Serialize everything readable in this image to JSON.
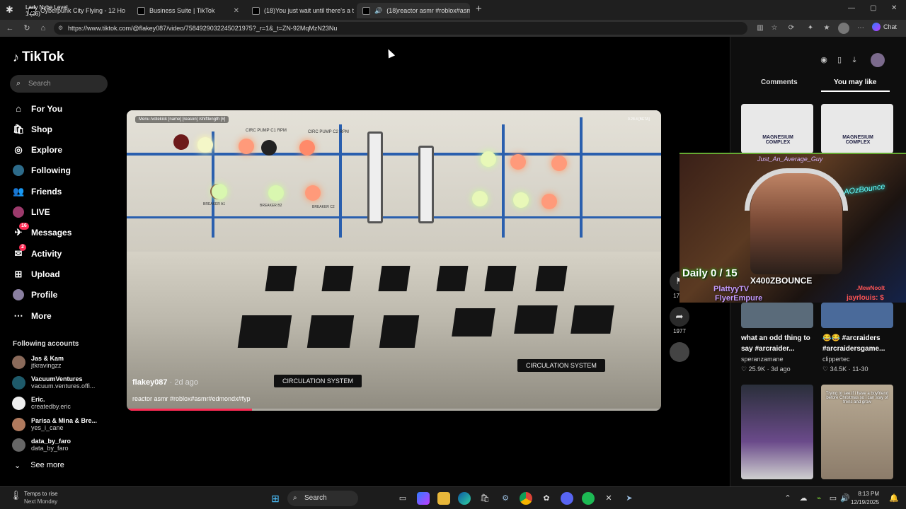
{
  "browser": {
    "tabs": [
      {
        "title": "Cyberpunk City Flying - 12 Ho",
        "overlay": "Lady Nybe Level 1 (26)"
      },
      {
        "title": "Business Suite | TikTok"
      },
      {
        "title": "(18)You just wait until there's a tai"
      },
      {
        "title": "(18)reactor asmr #roblox#asm"
      }
    ],
    "new_tab": "+",
    "url": "https://www.tiktok.com/@flakey087/video/7584929032245021975?_r=1&_t=ZN-92MqMzN23Nu",
    "chat_label": "Chat"
  },
  "sidebar": {
    "logo": "TikTok",
    "search_placeholder": "Search",
    "nav": [
      {
        "label": "For You",
        "icon": "home-icon"
      },
      {
        "label": "Shop",
        "icon": "shop-icon"
      },
      {
        "label": "Explore",
        "icon": "compass-icon"
      },
      {
        "label": "Following",
        "icon": "following-icon"
      },
      {
        "label": "Friends",
        "icon": "friends-icon"
      },
      {
        "label": "LIVE",
        "icon": "live-icon"
      },
      {
        "label": "Messages",
        "icon": "messages-icon",
        "badge": "16"
      },
      {
        "label": "Activity",
        "icon": "activity-icon",
        "badge": "2"
      },
      {
        "label": "Upload",
        "icon": "upload-icon"
      },
      {
        "label": "Profile",
        "icon": "profile-avatar"
      },
      {
        "label": "More",
        "icon": "more-icon"
      }
    ],
    "following_title": "Following accounts",
    "accounts": [
      {
        "name": "Jas & Kam",
        "handle": "jtkravingzz"
      },
      {
        "name": "VacuumVentures",
        "handle": "vacuum.ventures.offi..."
      },
      {
        "name": "Eric.",
        "handle": "createdby.eric"
      },
      {
        "name": "Parisa & Mina & Bre...",
        "handle": "yes_i_cane"
      },
      {
        "name": "data_by_faro",
        "handle": "data_by_faro"
      }
    ],
    "see_more": "See more"
  },
  "video": {
    "author": "flakey087",
    "ago": "· 2d ago",
    "description": "reactor asmr #roblox#asmr#edmondx#fyp",
    "progress": 0.235,
    "hud": "Menu   /votekick [name] [reason]   /shiftlength [#]",
    "version": "0.28.4 [BETA]",
    "signs": [
      "CIRCULATION SYSTEM",
      "CIRCULATION SYSTEM"
    ],
    "panel_labels": [
      "CIRC PUMP C1 RPM",
      "CIRC PUMP C2 RPM",
      "BREAKER A1",
      "BREAKER B2",
      "BREAKER C2"
    ]
  },
  "actions": [
    {
      "count": "1742",
      "icon": "bookmark-icon"
    },
    {
      "count": "1977",
      "icon": "share-icon"
    }
  ],
  "right": {
    "tabs": [
      "Comments",
      "You may like"
    ],
    "items": [
      {
        "title": "what an odd thing to say #arcraider...",
        "user": "speranzamane",
        "likes": "25.9K",
        "age": "3d ago"
      },
      {
        "title": "😂😂 #arcraiders #arcraidersgame...",
        "user": "clippertec",
        "likes": "34.5K",
        "age": "11-30"
      }
    ],
    "thumb_top_texts": [
      "MAGNESIUM COMPLEX",
      "MAGNESIUM COMPLEX"
    ],
    "thumb_bottom_text": "Trying to see if i have a boyfriend before Christmas so i can stay of frens and grow"
  },
  "overlay": {
    "daily": "Daily 0 / 15",
    "name": "X400ZBOUNCE",
    "sub1": "PlattyyTV",
    "sub2": "FlyerEmpure",
    "top": "Just_An_Average_Guy",
    "neon": "AOzBounce",
    "r1": ".MewNoolt",
    "r2": "jayrlouis: $"
  },
  "taskbar": {
    "weather_title": "Temps to rise",
    "weather_sub": "Next Monday",
    "search": "Search",
    "time": "8:13 PM",
    "date": "12/19/2025"
  },
  "colors": {
    "accent": "#fe2c55",
    "bg": "#000000"
  }
}
